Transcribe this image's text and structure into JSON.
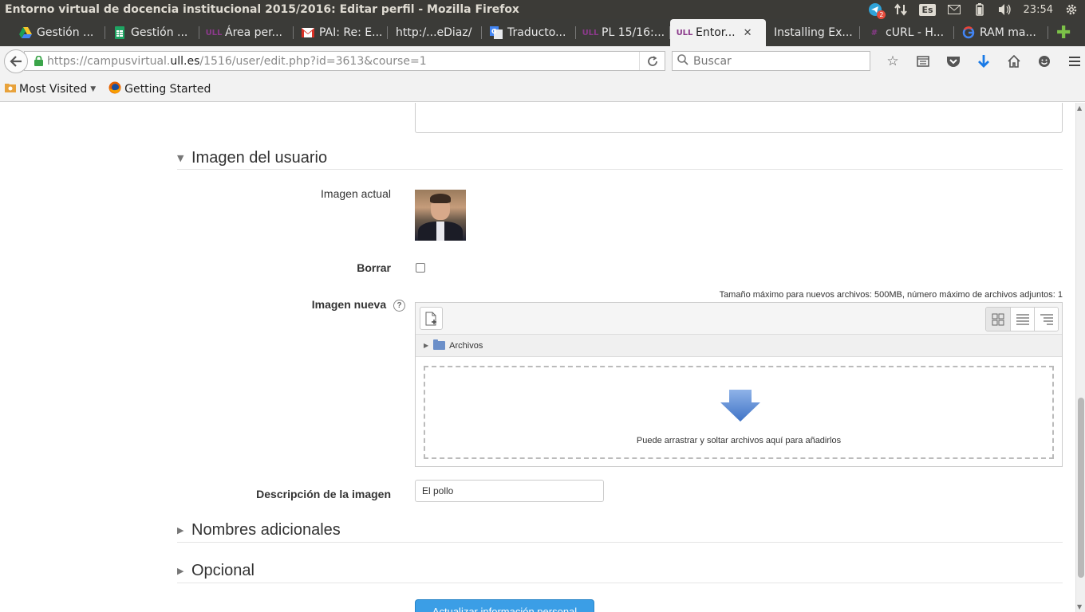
{
  "window": {
    "title": "Entorno virtual de docencia institucional 2015/2016: Editar perfil - Mozilla Firefox"
  },
  "system_tray": {
    "telegram_badge": "2",
    "keyboard_lang": "Es",
    "clock": "23:54"
  },
  "tabs": [
    {
      "label": "Gestión ...",
      "icon": "google-drive-icon",
      "active": false
    },
    {
      "label": "Gestión ...",
      "icon": "google-sheets-icon",
      "active": false
    },
    {
      "label": "Área per...",
      "icon": "ull-icon",
      "active": false
    },
    {
      "label": "PAI: Re: E...",
      "icon": "gmail-icon",
      "active": false
    },
    {
      "label": "http:/...eDiaz/",
      "icon": "",
      "active": false
    },
    {
      "label": "Traducto...",
      "icon": "google-translate-icon",
      "active": false
    },
    {
      "label": "PL 15/16:...",
      "icon": "ull-icon",
      "active": false
    },
    {
      "label": "Entor...",
      "icon": "ull-icon",
      "active": true
    },
    {
      "label": "Installing Ex...",
      "icon": "",
      "active": false
    },
    {
      "label": "cURL - H...",
      "icon": "curl-icon",
      "active": false
    },
    {
      "label": "RAM ma...",
      "icon": "google-icon",
      "active": false
    }
  ],
  "navbar": {
    "url_prefix": "https://campusvirtual.",
    "url_domain": "ull.es",
    "url_suffix": "/1516/user/edit.php?id=3613&course=1",
    "search_placeholder": "Buscar"
  },
  "bookmarks": [
    {
      "label": "Most Visited",
      "icon": "folder-icon",
      "dropdown": true
    },
    {
      "label": "Getting Started",
      "icon": "firefox-icon",
      "dropdown": false
    }
  ],
  "form": {
    "section_user_image": "Imagen del usuario",
    "current_image_label": "Imagen actual",
    "delete_label": "Borrar",
    "new_image_label": "Imagen nueva",
    "max_size_text": "Tamaño máximo para nuevos archivos: 500MB, número máximo de archivos adjuntos: 1",
    "folder_label": "Archivos",
    "drop_text": "Puede arrastrar y soltar archivos aquí para añadirlos",
    "image_description_label": "Descripción de la imagen",
    "image_description_value": "El pollo",
    "section_additional_names": "Nombres adicionales",
    "section_optional": "Opcional",
    "submit_label": "Actualizar información personal"
  },
  "colors": {
    "os_panel": "#3c3b37",
    "tab_strip": "#3b3b38",
    "submit_button": "#3b9ee6",
    "ull_purple": "#8b3a8b"
  }
}
